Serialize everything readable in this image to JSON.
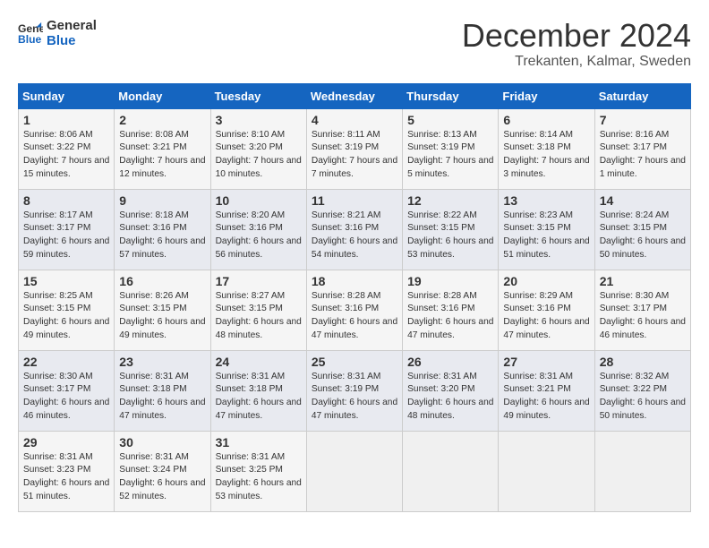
{
  "logo": {
    "line1": "General",
    "line2": "Blue"
  },
  "title": "December 2024",
  "location": "Trekanten, Kalmar, Sweden",
  "weekdays": [
    "Sunday",
    "Monday",
    "Tuesday",
    "Wednesday",
    "Thursday",
    "Friday",
    "Saturday"
  ],
  "weeks": [
    [
      {
        "day": "1",
        "sunrise": "8:06 AM",
        "sunset": "3:22 PM",
        "daylight": "7 hours and 15 minutes."
      },
      {
        "day": "2",
        "sunrise": "8:08 AM",
        "sunset": "3:21 PM",
        "daylight": "7 hours and 12 minutes."
      },
      {
        "day": "3",
        "sunrise": "8:10 AM",
        "sunset": "3:20 PM",
        "daylight": "7 hours and 10 minutes."
      },
      {
        "day": "4",
        "sunrise": "8:11 AM",
        "sunset": "3:19 PM",
        "daylight": "7 hours and 7 minutes."
      },
      {
        "day": "5",
        "sunrise": "8:13 AM",
        "sunset": "3:19 PM",
        "daylight": "7 hours and 5 minutes."
      },
      {
        "day": "6",
        "sunrise": "8:14 AM",
        "sunset": "3:18 PM",
        "daylight": "7 hours and 3 minutes."
      },
      {
        "day": "7",
        "sunrise": "8:16 AM",
        "sunset": "3:17 PM",
        "daylight": "7 hours and 1 minute."
      }
    ],
    [
      {
        "day": "8",
        "sunrise": "8:17 AM",
        "sunset": "3:17 PM",
        "daylight": "6 hours and 59 minutes."
      },
      {
        "day": "9",
        "sunrise": "8:18 AM",
        "sunset": "3:16 PM",
        "daylight": "6 hours and 57 minutes."
      },
      {
        "day": "10",
        "sunrise": "8:20 AM",
        "sunset": "3:16 PM",
        "daylight": "6 hours and 56 minutes."
      },
      {
        "day": "11",
        "sunrise": "8:21 AM",
        "sunset": "3:16 PM",
        "daylight": "6 hours and 54 minutes."
      },
      {
        "day": "12",
        "sunrise": "8:22 AM",
        "sunset": "3:15 PM",
        "daylight": "6 hours and 53 minutes."
      },
      {
        "day": "13",
        "sunrise": "8:23 AM",
        "sunset": "3:15 PM",
        "daylight": "6 hours and 51 minutes."
      },
      {
        "day": "14",
        "sunrise": "8:24 AM",
        "sunset": "3:15 PM",
        "daylight": "6 hours and 50 minutes."
      }
    ],
    [
      {
        "day": "15",
        "sunrise": "8:25 AM",
        "sunset": "3:15 PM",
        "daylight": "6 hours and 49 minutes."
      },
      {
        "day": "16",
        "sunrise": "8:26 AM",
        "sunset": "3:15 PM",
        "daylight": "6 hours and 49 minutes."
      },
      {
        "day": "17",
        "sunrise": "8:27 AM",
        "sunset": "3:15 PM",
        "daylight": "6 hours and 48 minutes."
      },
      {
        "day": "18",
        "sunrise": "8:28 AM",
        "sunset": "3:16 PM",
        "daylight": "6 hours and 47 minutes."
      },
      {
        "day": "19",
        "sunrise": "8:28 AM",
        "sunset": "3:16 PM",
        "daylight": "6 hours and 47 minutes."
      },
      {
        "day": "20",
        "sunrise": "8:29 AM",
        "sunset": "3:16 PM",
        "daylight": "6 hours and 47 minutes."
      },
      {
        "day": "21",
        "sunrise": "8:30 AM",
        "sunset": "3:17 PM",
        "daylight": "6 hours and 46 minutes."
      }
    ],
    [
      {
        "day": "22",
        "sunrise": "8:30 AM",
        "sunset": "3:17 PM",
        "daylight": "6 hours and 46 minutes."
      },
      {
        "day": "23",
        "sunrise": "8:31 AM",
        "sunset": "3:18 PM",
        "daylight": "6 hours and 47 minutes."
      },
      {
        "day": "24",
        "sunrise": "8:31 AM",
        "sunset": "3:18 PM",
        "daylight": "6 hours and 47 minutes."
      },
      {
        "day": "25",
        "sunrise": "8:31 AM",
        "sunset": "3:19 PM",
        "daylight": "6 hours and 47 minutes."
      },
      {
        "day": "26",
        "sunrise": "8:31 AM",
        "sunset": "3:20 PM",
        "daylight": "6 hours and 48 minutes."
      },
      {
        "day": "27",
        "sunrise": "8:31 AM",
        "sunset": "3:21 PM",
        "daylight": "6 hours and 49 minutes."
      },
      {
        "day": "28",
        "sunrise": "8:32 AM",
        "sunset": "3:22 PM",
        "daylight": "6 hours and 50 minutes."
      }
    ],
    [
      {
        "day": "29",
        "sunrise": "8:31 AM",
        "sunset": "3:23 PM",
        "daylight": "6 hours and 51 minutes."
      },
      {
        "day": "30",
        "sunrise": "8:31 AM",
        "sunset": "3:24 PM",
        "daylight": "6 hours and 52 minutes."
      },
      {
        "day": "31",
        "sunrise": "8:31 AM",
        "sunset": "3:25 PM",
        "daylight": "6 hours and 53 minutes."
      },
      null,
      null,
      null,
      null
    ]
  ]
}
